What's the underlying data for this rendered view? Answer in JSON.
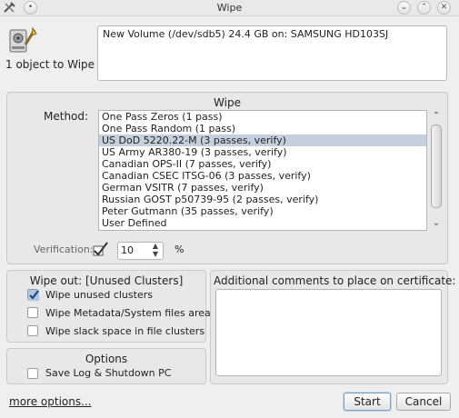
{
  "window": {
    "title": "Wipe",
    "tools_icon": "tools-icon",
    "pin_icon": "pin-icon",
    "controls": [
      "minimize-icon",
      "maximize-icon",
      "close-icon"
    ]
  },
  "header": {
    "object_count_label": "1 object to Wipe",
    "target_text": "New Volume (/dev/sdb5) 24.4 GB on: SAMSUNG HD103SJ"
  },
  "wipe": {
    "group_title": "Wipe",
    "method_label": "Method:",
    "methods": [
      "One Pass Zeros (1 pass)",
      "One Pass Random (1 pass)",
      "US DoD 5220.22-M (3 passes, verify)",
      "US Army AR380-19 (3 passes, verify)",
      "Canadian OPS-II (7 passes, verify)",
      "Canadian CSEC ITSG-06 (3 passes, verify)",
      "German VSITR (7 passes, verify)",
      "Russian GOST p50739-95 (2 passes, verify)",
      "Peter Gutmann (35 passes, verify)",
      "User Defined"
    ],
    "selected_method": "US DoD 5220.22-M (3 passes, verify)",
    "verification_label": "Verification:",
    "verification_value": "10",
    "verification_unit": "%"
  },
  "wipe_out": {
    "title": "Wipe out: [Unused Clusters]",
    "options": [
      {
        "label": "Wipe unused clusters",
        "checked": true
      },
      {
        "label": "Wipe Metadata/System files area",
        "checked": false
      },
      {
        "label": "Wipe slack space in file clusters",
        "checked": false
      }
    ]
  },
  "options": {
    "title": "Options",
    "save_log_label": "Save Log & Shutdown PC",
    "save_log_checked": false
  },
  "comments": {
    "label": "Additional comments to place on certificate:",
    "value": ""
  },
  "footer": {
    "more_options_label": "more options...",
    "start_label": "Start",
    "cancel_label": "Cancel"
  },
  "colors": {
    "selection": "#c5d0de",
    "default_button_border": "#7fa3c7"
  }
}
